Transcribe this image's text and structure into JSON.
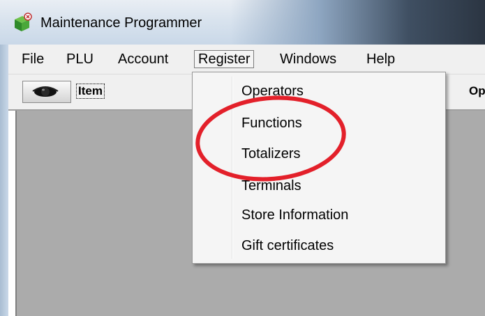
{
  "window": {
    "title": "Maintenance Programmer",
    "icon": "maintenance-app-icon"
  },
  "menubar": {
    "items": [
      {
        "label": "File"
      },
      {
        "label": "PLU"
      },
      {
        "label": "Account"
      },
      {
        "label": "Register",
        "active": true
      },
      {
        "label": "Windows"
      },
      {
        "label": "Help"
      }
    ]
  },
  "toolbar": {
    "item_button_icon": "eye-icon",
    "item_label": "Item",
    "right_label": "Opera"
  },
  "register_menu": {
    "items": [
      {
        "label": "Operators"
      },
      {
        "label": "Functions"
      },
      {
        "label": "Totalizers"
      },
      {
        "label": "Terminals"
      },
      {
        "label": "Store Information"
      },
      {
        "label": "Gift certificates"
      }
    ]
  },
  "annotation": {
    "color": "#e3202a",
    "shape": "ellipse"
  }
}
